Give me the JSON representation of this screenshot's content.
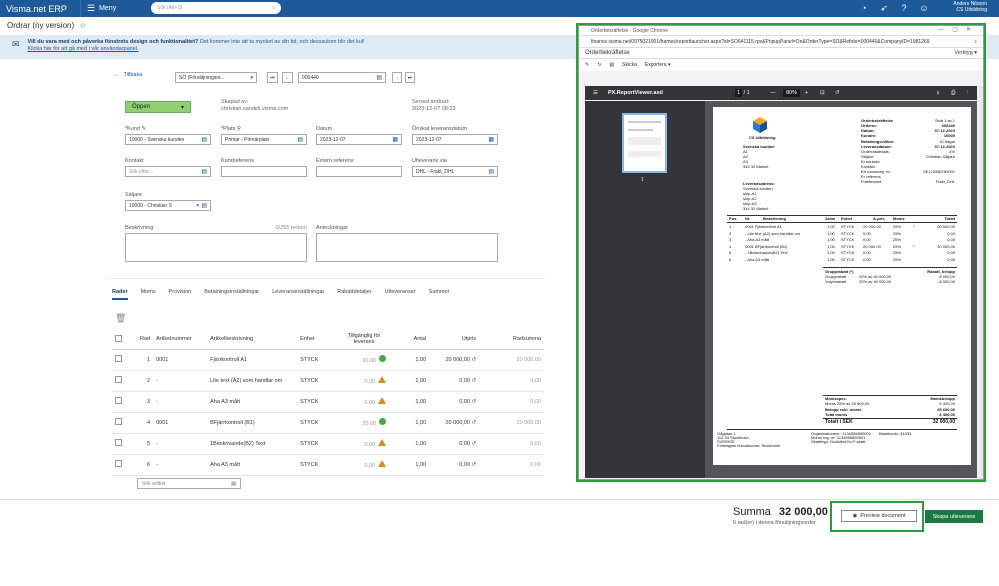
{
  "topbar": {
    "brand": "Visma.net ERP",
    "menu": "Meny",
    "search_placeholder": "Sök (Alt+S)",
    "user_name": "Anders Nilsson",
    "user_company": "CS Utbildning"
  },
  "page": {
    "title": "Ordrar (ny version)"
  },
  "info": {
    "line1_bold": "Vill du vara med och påverka fönstrets design och funktionalitet?",
    "line1": "Det kommer inte att ta mycket av din tid, och desssutom blir det kul!",
    "line2": "Klicka här för att gå med i vår användarpanel."
  },
  "form": {
    "back": "Tillbaka",
    "order_type": "SO (Försäljningsor...",
    "order_nr": "000440",
    "status": "Öppen",
    "created_by_label": "Skapad av:",
    "created_by": "christian.sandell.visma.com",
    "changed_label": "Senast ändrad:",
    "changed": "2023-12-07 08:33",
    "kund_label": "Kund",
    "kund": "10000 - Svenska kunden",
    "plats_label": "Plats",
    "plats": "Primär - Primärplats",
    "datum_label": "Datum",
    "datum": "2023-12-07",
    "lev_datum_label": "Önskat leveransdatum",
    "lev_datum": "2023-12-07",
    "kontakt_label": "Kontakt",
    "kontakt_placeholder": "Sök efter...",
    "kundref_label": "Kundreferens",
    "extref_label": "Extern referens",
    "levvia_label": "Utleverans via",
    "levvia": "DHL - Frakt_DHL",
    "saljare_label": "Säljare",
    "saljare": "10000 - Christian S",
    "beskr_label": "Beskrivning",
    "beskr_count": "0/255 tecken",
    "antek_label": "Anteckningar"
  },
  "tabs": [
    "Rader",
    "Moms",
    "Provision",
    "Betalningsinställningar",
    "Leveransinställningar",
    "Rabattdetaljer",
    "Utleveranser",
    "Summor"
  ],
  "grid": {
    "headers": {
      "rad": "Rad",
      "artnr": "Artikelnummer",
      "beskr": "Artikelbeskrivning",
      "enhet": "Enhet",
      "tillg": "Tillgänglig för leverans",
      "antal": "Antal",
      "utpris": "Utpris",
      "radsumma": "Radsumma"
    },
    "rows": [
      {
        "rad": "1",
        "artnr": "0001",
        "beskr": "Fjärrkontroll A1",
        "enhet": "STYCK",
        "tillg": "20,00",
        "ok": true,
        "antal": "1,00",
        "utpris": "20 000,00",
        "radsumma": "20 000,00"
      },
      {
        "rad": "2",
        "artnr": "-",
        "beskr": "Lite text (A2) som handlar om",
        "enhet": "STYCK",
        "tillg": "0,00",
        "ok": false,
        "antal": "1,00",
        "utpris": "0,00",
        "radsumma": "0,00"
      },
      {
        "rad": "3",
        "artnr": "-",
        "beskr": "Aha A3 mått",
        "enhet": "STYCK",
        "tillg": "0,00",
        "ok": false,
        "antal": "1,00",
        "utpris": "0,00",
        "radsumma": "0,00"
      },
      {
        "rad": "4",
        "artnr": "0001",
        "beskr": "BFjärrkontroll (B1)",
        "enhet": "STYCK",
        "tillg": "20,00",
        "ok": true,
        "antal": "1,00",
        "utpris": "20 000,00",
        "radsumma": "20 000,00"
      },
      {
        "rad": "5",
        "artnr": "-",
        "beskr": "1Beskrivande(B2) Text",
        "enhet": "STYCK",
        "tillg": "0,00",
        "ok": false,
        "antal": "1,00",
        "utpris": "0,00",
        "radsumma": "0,00"
      },
      {
        "rad": "6",
        "artnr": "-",
        "beskr": "Aha A3 mått",
        "enhet": "STYCK",
        "tillg": "0,00",
        "ok": false,
        "antal": "1,00",
        "utpris": "0,00",
        "radsumma": "0,00"
      }
    ],
    "search_placeholder": "Sök artikel"
  },
  "footer": {
    "summa_label": "Summa",
    "summa": "32 000,00",
    "rows_text": "6 rad(er) i denna försäljningsorder",
    "preview": "Preview document",
    "skapa": "Skapa utleverans"
  },
  "popup": {
    "title": "Orderbekräftelse - Google Chrome",
    "url": "finance.visma.net/0975021001/frames/reportlauncher.aspx?id=SO641115.rpx&PopupPanel=On&OrderType=SO&Refnbr=000440&CompanyID=1981269",
    "heading": "Orderbekräftelse",
    "verktyg": "Verktyg",
    "skicka": "Skicka",
    "exportera": "Exportera",
    "pdf_name": "PX.ReportViewer.axd",
    "page": "1",
    "pages": "/ 1",
    "zoom": "80%",
    "thumb_num": "1",
    "doc": {
      "company": "CS Utbildning",
      "doc_title": "Orderbekräftelse",
      "sida": "Sida 1 av 1",
      "ordernr_label": "Ordernr:",
      "ordernr": "000440",
      "datum_label": "Datum:",
      "datum": "07-12-2023",
      "kundnr_label": "Kundnr:",
      "kundnr": "10000",
      "betvillkor_label": "Betalningsvillkor:",
      "betvillkor": "10 dagar",
      "levdatum_label": "Leveransdatum:",
      "levdatum": "07-12-2023",
      "orderrabatt_label": "Orderrabattsats:",
      "orderrabatt": "4%",
      "saljare_label": "Säljare",
      "saljare": "Christian Säljare",
      "er_kontakt": "Er kontakt:",
      "kontakt": "Kontakt:",
      "er_moms_label": "Ert momsreg. nr:",
      "er_moms": "SE123456789001",
      "er_ref": "Er referens",
      "fraktmetod_label": "Fraktmetod",
      "fraktmetod": "Frakt_DHL",
      "cust_name": "Svenska kunden",
      "cust_a1": "A1",
      "cust_a2": "A2",
      "cust_a3": "A3",
      "cust_city": "344 32 Malmö",
      "levadr_label": "Leveransadress:",
      "ship1": "ship-A1",
      "ship2": "ship-A2",
      "ship3": "ship-A3",
      "ship_city": "344 32 Malmö",
      "cols": {
        "pos": "Pos.",
        "nr": "Nr.",
        "beskr": "Beskrivning",
        "antal": "Antal",
        "enhet": "Enhet",
        "apris": "A-pris",
        "moms": "Moms",
        "total": "Totalt"
      },
      "lines": [
        {
          "pos": "1",
          "desc": "0001  Fjärrkontroll A1",
          "antal": "1,00",
          "enhet": "STYCK",
          "apris": "20 000,00",
          "moms": "25%",
          "mark": "*",
          "total": "20 000,00"
        },
        {
          "pos": "2",
          "desc": "- Lite text (A2) som handlar om",
          "antal": "1,00",
          "enhet": "STYCK",
          "apris": "0,00",
          "moms": "25%",
          "mark": "",
          "total": "0,00"
        },
        {
          "pos": "3",
          "desc": "- Aha A3 mått",
          "antal": "1,00",
          "enhet": "STYCK",
          "apris": "0,00",
          "moms": "25%",
          "mark": "",
          "total": "0,00"
        },
        {
          "pos": "4",
          "desc": "0001  BFjärrkontroll (B1)",
          "antal": "1,00",
          "enhet": "STYCK",
          "apris": "20 000,00",
          "moms": "25%",
          "mark": "*",
          "total": "20 000,00"
        },
        {
          "pos": "5",
          "desc": "- 1Beskrivande(B2) Text",
          "antal": "1,00",
          "enhet": "STYCK",
          "apris": "0,00",
          "moms": "25%",
          "mark": "",
          "total": "0,00"
        },
        {
          "pos": "6",
          "desc": "- Aha A3 mått",
          "antal": "1,00",
          "enhet": "STYCK",
          "apris": "0,00",
          "moms": "25%",
          "mark": "",
          "total": "0,00"
        }
      ],
      "grupprabatt_label": "Grupprabatt (*)",
      "rabatt_label": "Rabatt, belopp",
      "gr1": "Grupprabatt",
      "gr1_desc": "20% av 40 000,00",
      "gr1_val": "-8 000,00",
      "gr2": "Volymrabatt",
      "gr2_desc": "20% av 40 000,00",
      "gr2_val": "-8 000,00",
      "momsspec_label": "Momsspec.",
      "momsbelopp_label": "Momsbelopp",
      "moms_line": "Moms",
      "moms_desc": "25% av 25 600,00",
      "moms_val": "6 400,00",
      "belopp_label": "Belopp exkl. moms",
      "belopp": "25 600,00",
      "total_moms_label": "Total moms",
      "total_moms": "6 400,00",
      "totalt_label": "Totalt i SEK",
      "totalt": "32 000,00",
      "foot_addr1": "Gågatan 1",
      "foot_addr2": "112 34 Stockholm",
      "foot_addr3": "SVERIGE",
      "foot_addr4": "Företagets huvudkontor: Stockholm",
      "foot_org": "Organisationsnr.: 1134556890001",
      "foot_moms": "Moms reg. nr: 1134556890001",
      "foot_skatt": "Skattetyp: Godkänd för F-skatt",
      "foot_bank": "Bankkonto: 44333"
    }
  }
}
